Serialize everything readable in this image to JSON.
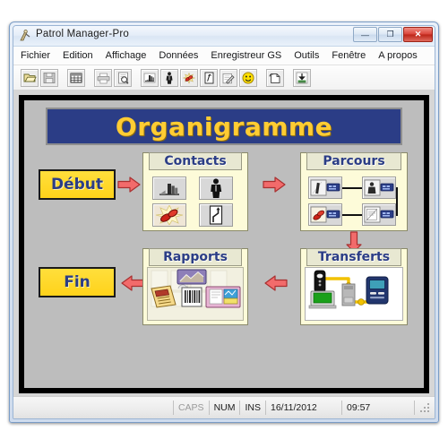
{
  "window": {
    "title": "Patrol Manager-Pro",
    "app_icon": "patrol-app-icon",
    "buttons": {
      "minimize": "—",
      "maximize": "❐",
      "close": "✕"
    }
  },
  "menubar": {
    "items": [
      {
        "label": "Fichier"
      },
      {
        "label": "Edition"
      },
      {
        "label": "Affichage"
      },
      {
        "label": "Données"
      },
      {
        "label": "Enregistreur GS"
      },
      {
        "label": "Outils"
      },
      {
        "label": "Fenêtre"
      },
      {
        "label": "A propos"
      }
    ]
  },
  "toolbar": {
    "buttons": [
      {
        "name": "open-folder-icon",
        "title": "Ouvrir"
      },
      {
        "name": "save-disk-icon",
        "title": "Enregistrer"
      },
      {
        "name": "table-grid-icon",
        "title": "Table"
      },
      {
        "name": "printer-icon",
        "title": "Imprimer"
      },
      {
        "name": "print-preview-icon",
        "title": "Aperçu"
      },
      {
        "name": "site-building-icon",
        "title": "Sites"
      },
      {
        "name": "person-agent-icon",
        "title": "Agents"
      },
      {
        "name": "incident-alert-icon",
        "title": "Incidents"
      },
      {
        "name": "badge-tag-icon",
        "title": "Badge"
      },
      {
        "name": "edit-pencil-icon",
        "title": "Edition"
      },
      {
        "name": "smiley-face-icon",
        "title": "Statut"
      },
      {
        "name": "new-page-icon",
        "title": "Nouveau"
      },
      {
        "name": "download-transfer-icon",
        "title": "Transfert"
      }
    ]
  },
  "diagram": {
    "banner": {
      "title": "Organigramme"
    },
    "start_box": {
      "label": "Début"
    },
    "end_box": {
      "label": "Fin"
    },
    "groups": [
      {
        "key": "contacts",
        "title": "Contacts",
        "tiles": [
          {
            "name": "site-building-icon"
          },
          {
            "name": "person-agent-icon"
          },
          {
            "name": "incident-alert-icon"
          },
          {
            "name": "route-path-icon"
          }
        ]
      },
      {
        "key": "parcours",
        "title": "Parcours",
        "tiles": [
          {
            "name": "checkpoint-site-icon"
          },
          {
            "name": "checkpoint-person-icon"
          },
          {
            "name": "checkpoint-incident-icon"
          },
          {
            "name": "checkpoint-report-icon"
          }
        ]
      },
      {
        "key": "rapports",
        "title": "Rapports",
        "tiles": [
          {
            "name": "report-chart-icon"
          },
          {
            "name": "report-barcode-icon"
          },
          {
            "name": "report-book-icon"
          },
          {
            "name": "report-document-icon"
          }
        ]
      },
      {
        "key": "transferts",
        "title": "Transferts",
        "tiles": [
          {
            "name": "handheld-reader-icon"
          },
          {
            "name": "docking-station-icon"
          },
          {
            "name": "computer-pc-icon"
          },
          {
            "name": "data-terminal-icon"
          }
        ]
      }
    ],
    "arrows": [
      {
        "name": "arrow-debut-to-contacts",
        "direction": "right"
      },
      {
        "name": "arrow-contacts-to-parcours",
        "direction": "right"
      },
      {
        "name": "arrow-parcours-to-transferts",
        "direction": "down"
      },
      {
        "name": "arrow-transferts-to-rapports",
        "direction": "left"
      },
      {
        "name": "arrow-rapports-to-fin",
        "direction": "left"
      }
    ]
  },
  "statusbar": {
    "caps": "CAPS",
    "num": "NUM",
    "ins": "INS",
    "date": "16/11/2012",
    "time": "09:57",
    "grip": "resize-grip-icon"
  }
}
